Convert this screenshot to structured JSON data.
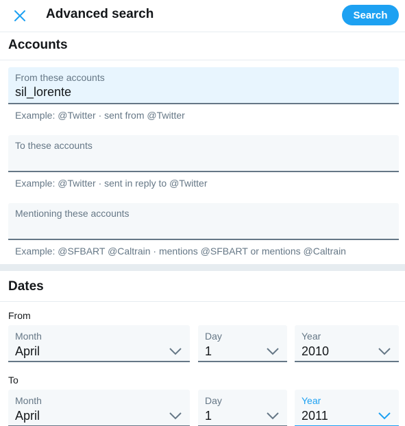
{
  "header": {
    "title": "Advanced search",
    "search_label": "Search"
  },
  "accounts": {
    "title": "Accounts",
    "fields": [
      {
        "label": "From these accounts",
        "value": "sil_lorente",
        "hint": "Example: @Twitter · sent from @Twitter"
      },
      {
        "label": "To these accounts",
        "value": "",
        "hint": "Example: @Twitter · sent in reply to @Twitter"
      },
      {
        "label": "Mentioning these accounts",
        "value": "",
        "hint": "Example: @SFBART @Caltrain · mentions @SFBART or mentions @Caltrain"
      }
    ]
  },
  "dates": {
    "title": "Dates",
    "from": {
      "label": "From",
      "month_label": "Month",
      "month": "April",
      "day_label": "Day",
      "day": "1",
      "year_label": "Year",
      "year": "2010"
    },
    "to": {
      "label": "To",
      "month_label": "Month",
      "month": "April",
      "day_label": "Day",
      "day": "1",
      "year_label": "Year",
      "year": "2011"
    }
  },
  "colors": {
    "accent": "#1da1f2",
    "text": "#14171a",
    "muted": "#657786",
    "field_bg": "#f5f8fa",
    "active_field_bg": "#e8f5fe"
  },
  "icons": {
    "close": "close-icon",
    "dropdown": "chevron-down-icon"
  }
}
